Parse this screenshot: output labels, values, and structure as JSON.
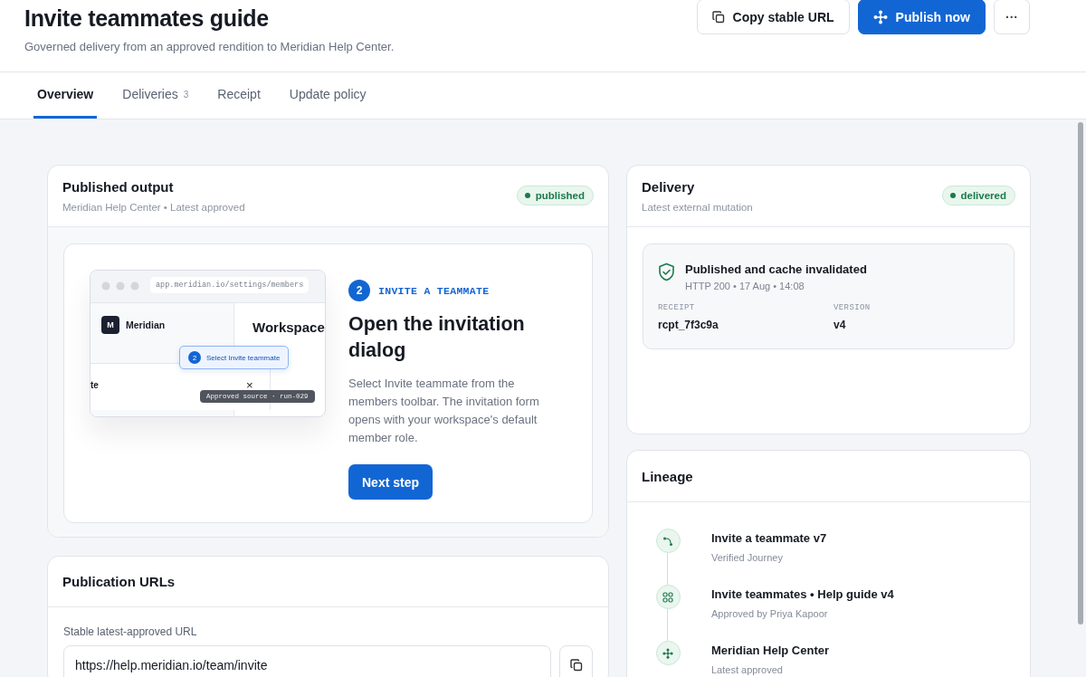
{
  "page": {
    "title": "Invite teammates guide",
    "subtitle": "Governed delivery from an approved rendition to Meridian Help Center."
  },
  "actions": [
    {
      "kind": "secondary",
      "label": "Copy stable URL"
    },
    {
      "kind": "primary",
      "label": "Publish now"
    },
    {
      "kind": "more",
      "label": "···"
    }
  ],
  "tabs": [
    {
      "label": "Overview",
      "selected": true
    },
    {
      "label": "Deliveries",
      "count": "3",
      "selected": false
    },
    {
      "label": "Receipt",
      "selected": false
    },
    {
      "label": "Update policy",
      "selected": false
    }
  ],
  "published_output": {
    "title": "Published output",
    "subtitle": "Meridian Help Center • Latest approved",
    "status": "published",
    "guide": {
      "preview": {
        "url": "app.meridian.io/settings/members",
        "logo": "M",
        "brand": "Meridian",
        "heading": "Workspace",
        "fragment": "te",
        "close": "×",
        "callout_step": "2",
        "callout": "Select Invite teammate",
        "source_tag": "Approved source · run-029"
      },
      "step": "2",
      "eyebrow": "INVITE A TEAMMATE",
      "heading": "Open the invitation dialog",
      "body": "Select Invite teammate from the members toolbar. The invitation form opens with your workspace's default member role.",
      "button": "Next step"
    }
  },
  "publication_urls": {
    "title": "Publication URLs",
    "field_label": "Stable latest-approved URL",
    "value": "https://help.meridian.io/team/invite"
  },
  "delivery": {
    "title": "Delivery",
    "subtitle": "Latest external mutation",
    "status": "delivered",
    "result": {
      "title": "Published and cache invalidated",
      "meta": "HTTP 200 • 17 Aug • 14:08",
      "fields": [
        {
          "label": "RECEIPT",
          "value": "rcpt_7f3c9a"
        },
        {
          "label": "VERSION",
          "value": "v4"
        }
      ]
    }
  },
  "lineage": {
    "title": "Lineage",
    "items": [
      {
        "kind": "journey",
        "title": "Invite a teammate v7",
        "subtitle": "Verified Journey"
      },
      {
        "kind": "guide",
        "title": "Invite teammates • Help guide v4",
        "subtitle": "Approved by Priya Kapoor"
      },
      {
        "kind": "destination",
        "title": "Meridian Help Center",
        "subtitle": "Latest approved"
      }
    ]
  }
}
